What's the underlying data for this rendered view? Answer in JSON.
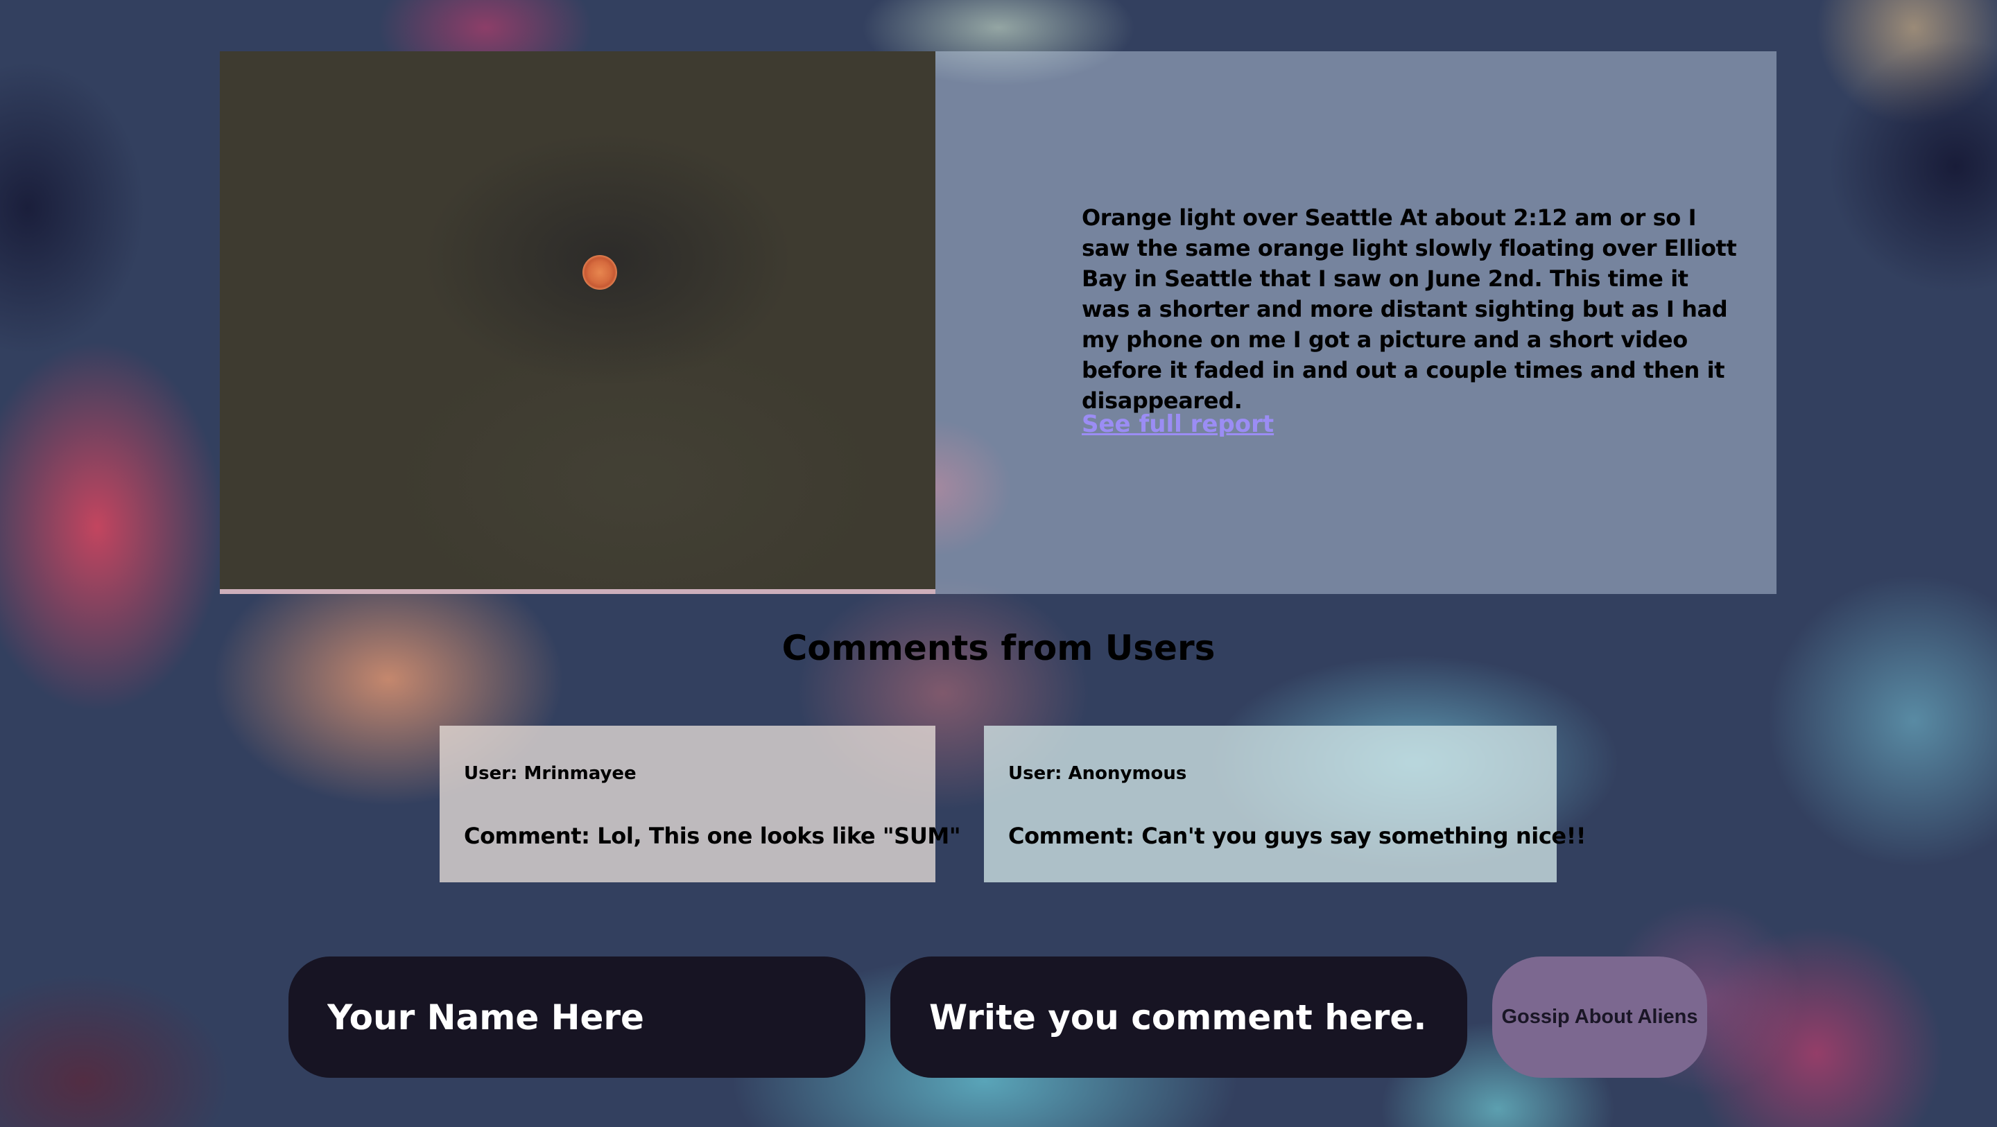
{
  "report": {
    "image_alt": "Orange light in the night sky",
    "description": "Orange light over Seattle At about 2:12 am or so I saw the same orange light slowly floating over Elliott Bay in Seattle that I saw on June 2nd. This time it was a shorter and more distant sighting but as I had my phone on me I got a picture and a short video before it faded in and out a couple times and then it disappeared.",
    "link_label": "See full report"
  },
  "comments": {
    "title": "Comments from Users",
    "items": [
      {
        "user": "User: Mrinmayee",
        "comment": "Comment: Lol, This one looks like \"SUM\""
      },
      {
        "user": "User: Anonymous",
        "comment": "Comment: Can't you guys say something nice!!"
      }
    ]
  },
  "form": {
    "name_placeholder": "Your Name Here",
    "comment_placeholder": "Write you comment here..",
    "submit_label": "Gossip About Aliens"
  },
  "colors": {
    "link": "#9b8df4",
    "input_bg": "#171423",
    "button_bg": "#7c6890"
  }
}
